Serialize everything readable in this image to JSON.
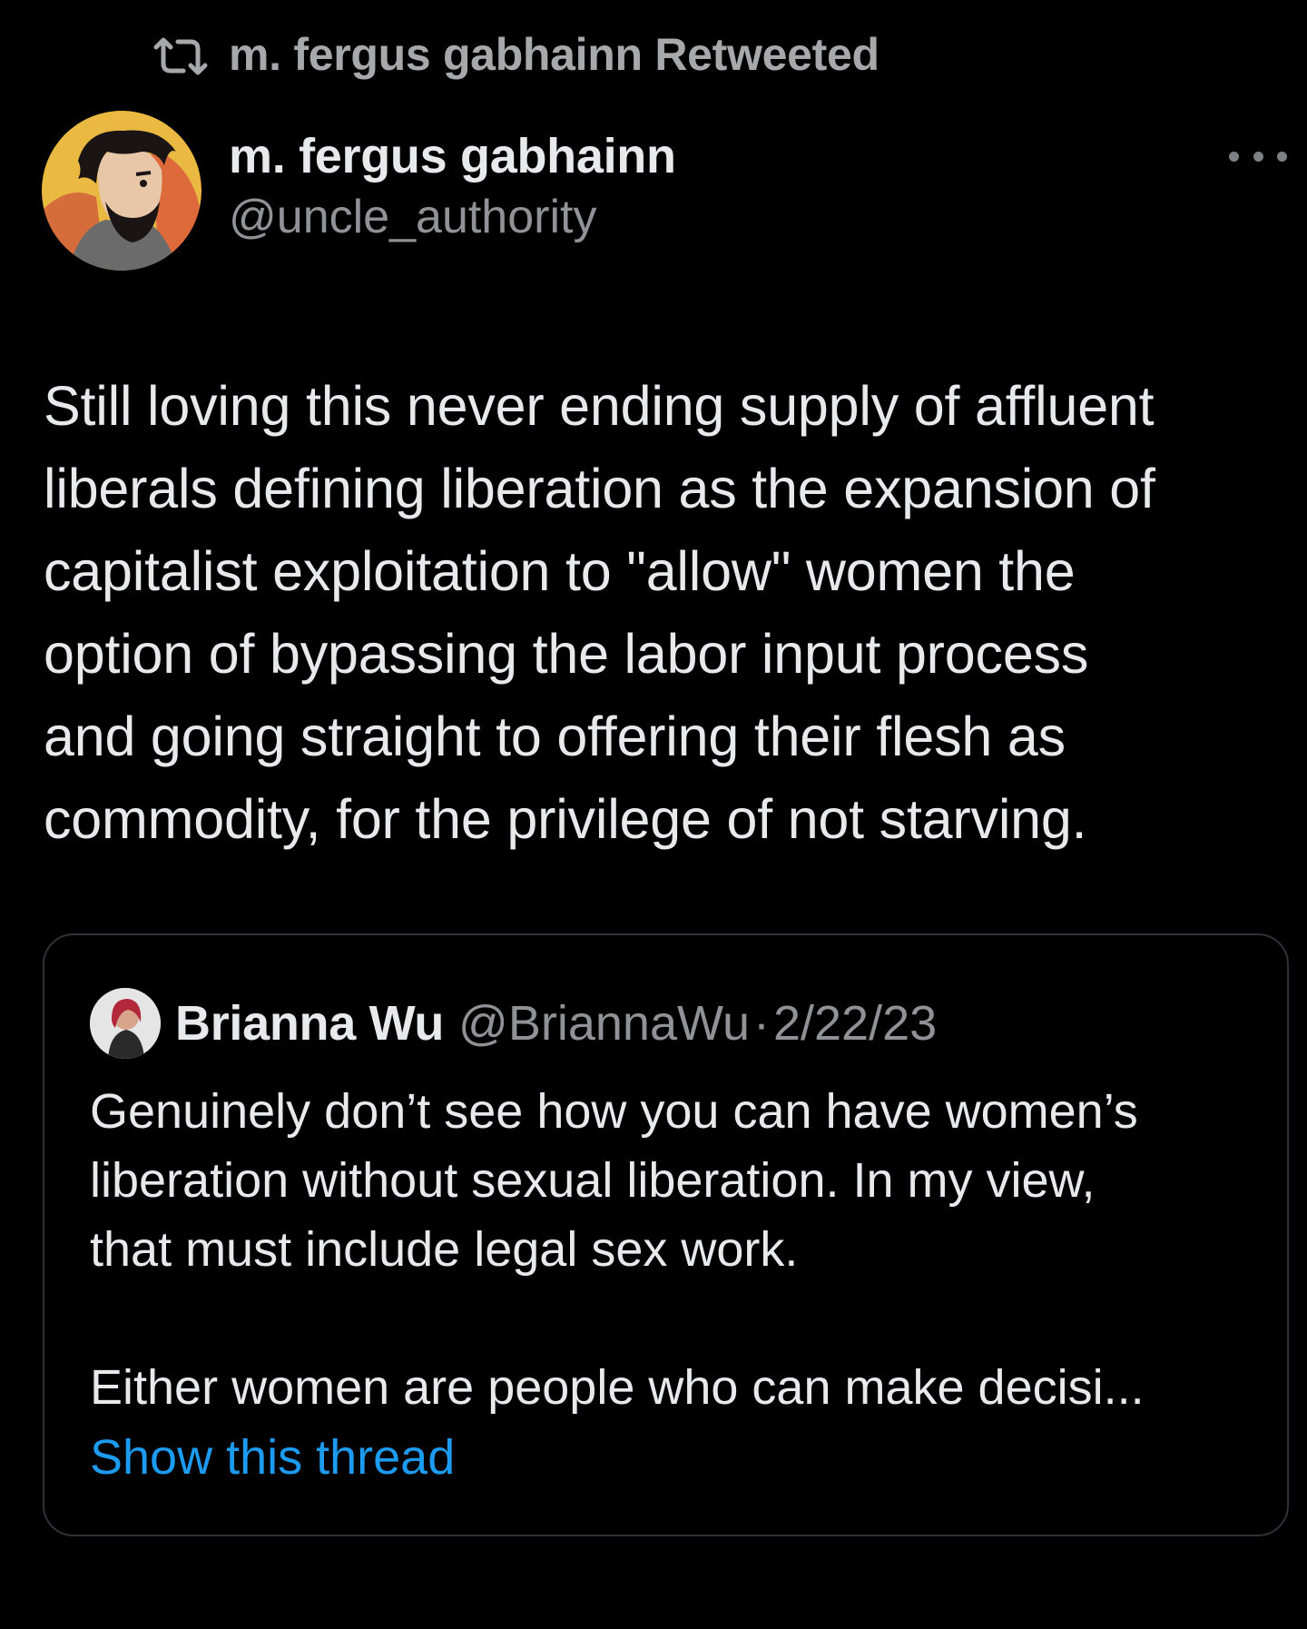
{
  "retweet": {
    "icon": "retweet-icon",
    "label": "m. fergus gabhainn Retweeted"
  },
  "tweet": {
    "author_name": "m. fergus gabhainn",
    "author_handle": "@uncle_authority",
    "more_icon": "more-horizontal-icon",
    "text_lines": [
      "Still loving this never ending supply of affluent",
      "liberals defining liberation as the expansion of",
      "capitalist exploitation to \"allow\" women the",
      "option of bypassing the labor input process",
      "and going straight to offering their flesh as",
      "commodity, for the privilege of not starving."
    ]
  },
  "quote": {
    "author_name": "Brianna Wu",
    "author_handle": "@BriannaWu",
    "separator": "·",
    "date": "2/22/23",
    "text_lines": [
      "Genuinely don’t see how you can have women’s",
      "liberation without sexual liberation. In my view,",
      "that must include legal sex work."
    ],
    "text_lines_2": [
      "Either women are people who can make decisi..."
    ],
    "show_thread_label": "Show this thread"
  },
  "colors": {
    "background": "#000000",
    "text_primary": "#e7e9ea",
    "text_secondary": "#8f9296",
    "link": "#1d9bf0",
    "border": "#2f3336"
  }
}
